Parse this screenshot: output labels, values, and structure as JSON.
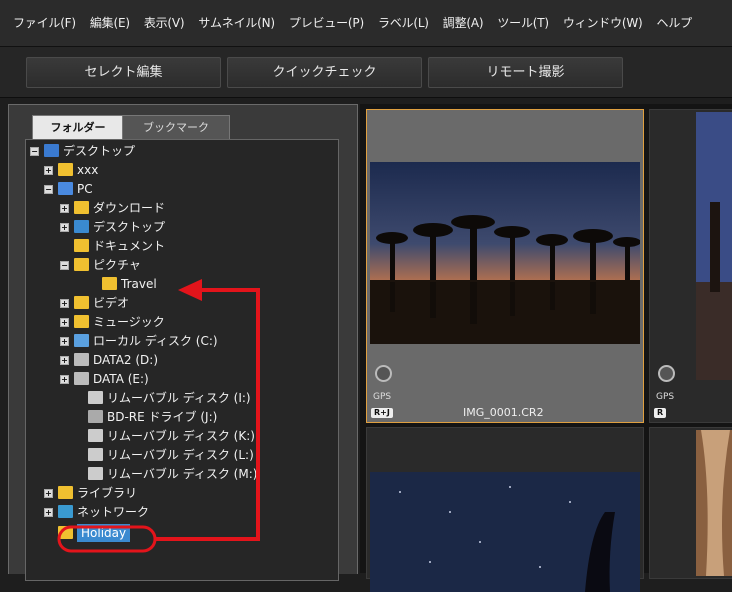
{
  "menu": [
    "ファイル(F)",
    "編集(E)",
    "表示(V)",
    "サムネイル(N)",
    "プレビュー(P)",
    "ラベル(L)",
    "調整(A)",
    "ツール(T)",
    "ウィンドウ(W)",
    "ヘルプ"
  ],
  "toolbar": {
    "select_edit": "セレクト編集",
    "quick_check": "クイックチェック",
    "remote_shoot": "リモート撮影"
  },
  "tabs": {
    "folder": "フォルダー",
    "bookmark": "ブックマーク"
  },
  "tree": {
    "desktop": "デスクトップ",
    "xxx": "xxx",
    "pc": "PC",
    "downloads": "ダウンロード",
    "desktop2": "デスクトップ",
    "documents": "ドキュメント",
    "pictures": "ピクチャ",
    "travel": "Travel",
    "video": "ビデオ",
    "music": "ミュージック",
    "local_disk": "ローカル ディスク (C:)",
    "data2": "DATA2 (D:)",
    "data": "DATA (E:)",
    "removable_i": "リムーバブル ディスク (I:)",
    "bdre": "BD-RE ドライブ (J:)",
    "removable_k": "リムーバブル ディスク (K:)",
    "removable_l": "リムーバブル ディスク (L:)",
    "removable_m": "リムーバブル ディスク (M:)",
    "library": "ライブラリ",
    "network": "ネットワーク",
    "holiday": "Holiday"
  },
  "thumbs": [
    {
      "gps": "GPS",
      "badge": "R+J",
      "name": "IMG_0001.CR2"
    },
    {
      "gps": "GPS",
      "badge": "R",
      "name": ""
    }
  ],
  "colors": {
    "accent_red": "#e3141b",
    "select_orange": "#e0a040",
    "folder_yellow": "#f0c030"
  }
}
